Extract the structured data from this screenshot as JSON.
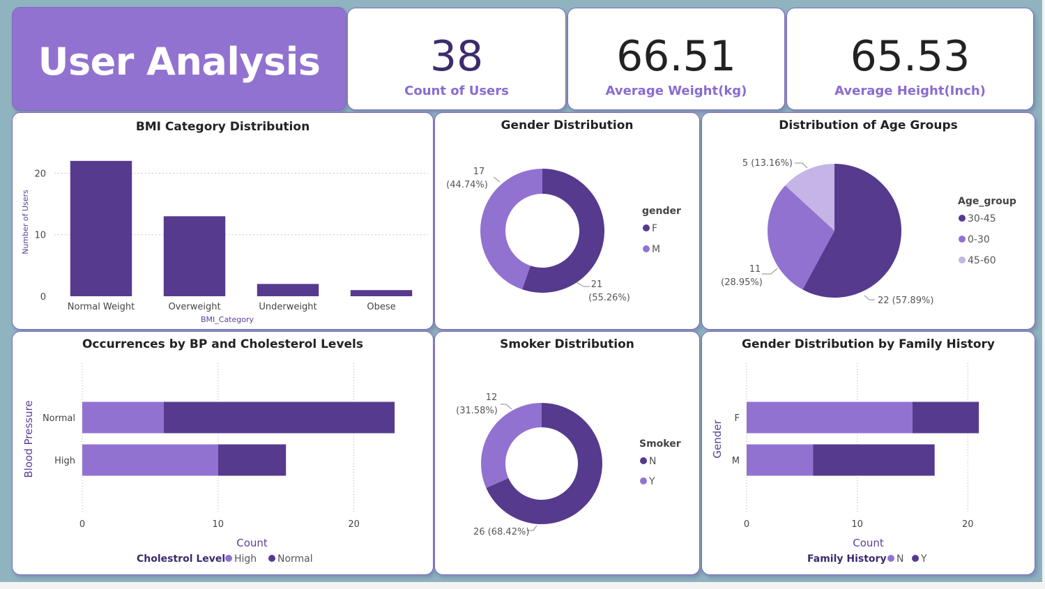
{
  "header": {
    "title": "User Analysis",
    "kpis": [
      {
        "value": "38",
        "label": "Count of Users",
        "color": "#3d2b6b"
      },
      {
        "value": "66.51",
        "label": "Average Weight(kg)",
        "color": "#222222"
      },
      {
        "value": "65.53",
        "label": "Average Height(Inch)",
        "color": "#222222"
      }
    ]
  },
  "colors": {
    "dark": "#563a8e",
    "mid": "#9272d0",
    "light": "#c5b5e6",
    "background": "#8fb4c0",
    "title_bg": "#9272d0"
  },
  "chart_data": [
    {
      "id": "bmi",
      "type": "bar",
      "title": "BMI Category Distribution",
      "xlabel": "BMI_Category",
      "ylabel": "Number of Users",
      "categories": [
        "Normal Weight",
        "Overweight",
        "Underweight",
        "Obese"
      ],
      "values": [
        22,
        13,
        2,
        1
      ],
      "yticks": [
        0,
        10,
        20
      ],
      "ylim": [
        0,
        23
      ],
      "grid": true
    },
    {
      "id": "gender",
      "type": "pie",
      "donut": true,
      "title": "Gender Distribution",
      "legend_title": "gender",
      "legend_position": "right",
      "slices": [
        {
          "label": "F",
          "value": 21,
          "pct": "(55.26%)",
          "color": "#563a8e"
        },
        {
          "label": "M",
          "value": 17,
          "pct": "(44.74%)",
          "color": "#9272d0"
        }
      ]
    },
    {
      "id": "age",
      "type": "pie",
      "donut": false,
      "title": "Distribution of Age Groups",
      "legend_title": "Age_group",
      "legend_position": "right",
      "slices": [
        {
          "label": "30-45",
          "value": 22,
          "pct": "(57.89%)",
          "color": "#563a8e"
        },
        {
          "label": "0-30",
          "value": 11,
          "pct": "(28.95%)",
          "color": "#9272d0"
        },
        {
          "label": "45-60",
          "value": 5,
          "pct": "(13.16%)",
          "color": "#c5b5e6"
        }
      ]
    },
    {
      "id": "bp",
      "type": "bar",
      "orientation": "horizontal",
      "stacked": true,
      "title": "Occurrences by BP and Cholesterol Levels",
      "xlabel": "Count",
      "ylabel": "Blood Pressure",
      "categories": [
        "Normal",
        "High"
      ],
      "series": [
        {
          "name": "High",
          "values": [
            6,
            10
          ],
          "color": "#9272d0"
        },
        {
          "name": "Normal",
          "values": [
            17,
            5
          ],
          "color": "#563a8e"
        }
      ],
      "xticks": [
        0,
        10,
        20
      ],
      "xlim": [
        0,
        25
      ],
      "legend_title": "Cholestrol Level",
      "legend_position": "bottom",
      "grid": true
    },
    {
      "id": "smoker",
      "type": "pie",
      "donut": true,
      "title": "Smoker Distribution",
      "legend_title": "Smoker",
      "legend_position": "right",
      "slices": [
        {
          "label": "N",
          "value": 26,
          "pct": "(68.42%)",
          "color": "#563a8e"
        },
        {
          "label": "Y",
          "value": 12,
          "pct": "(31.58%)",
          "color": "#9272d0"
        }
      ]
    },
    {
      "id": "family",
      "type": "bar",
      "orientation": "horizontal",
      "stacked": true,
      "title": "Gender Distribution by Family History",
      "xlabel": "Count",
      "ylabel": "Gender",
      "categories": [
        "F",
        "M"
      ],
      "series": [
        {
          "name": "N",
          "values": [
            15,
            6
          ],
          "color": "#9272d0"
        },
        {
          "name": "Y",
          "values": [
            6,
            11
          ],
          "color": "#563a8e"
        }
      ],
      "xticks": [
        0,
        10,
        20
      ],
      "xlim": [
        0,
        22
      ],
      "legend_title": "Family History",
      "legend_position": "bottom",
      "grid": true
    }
  ]
}
